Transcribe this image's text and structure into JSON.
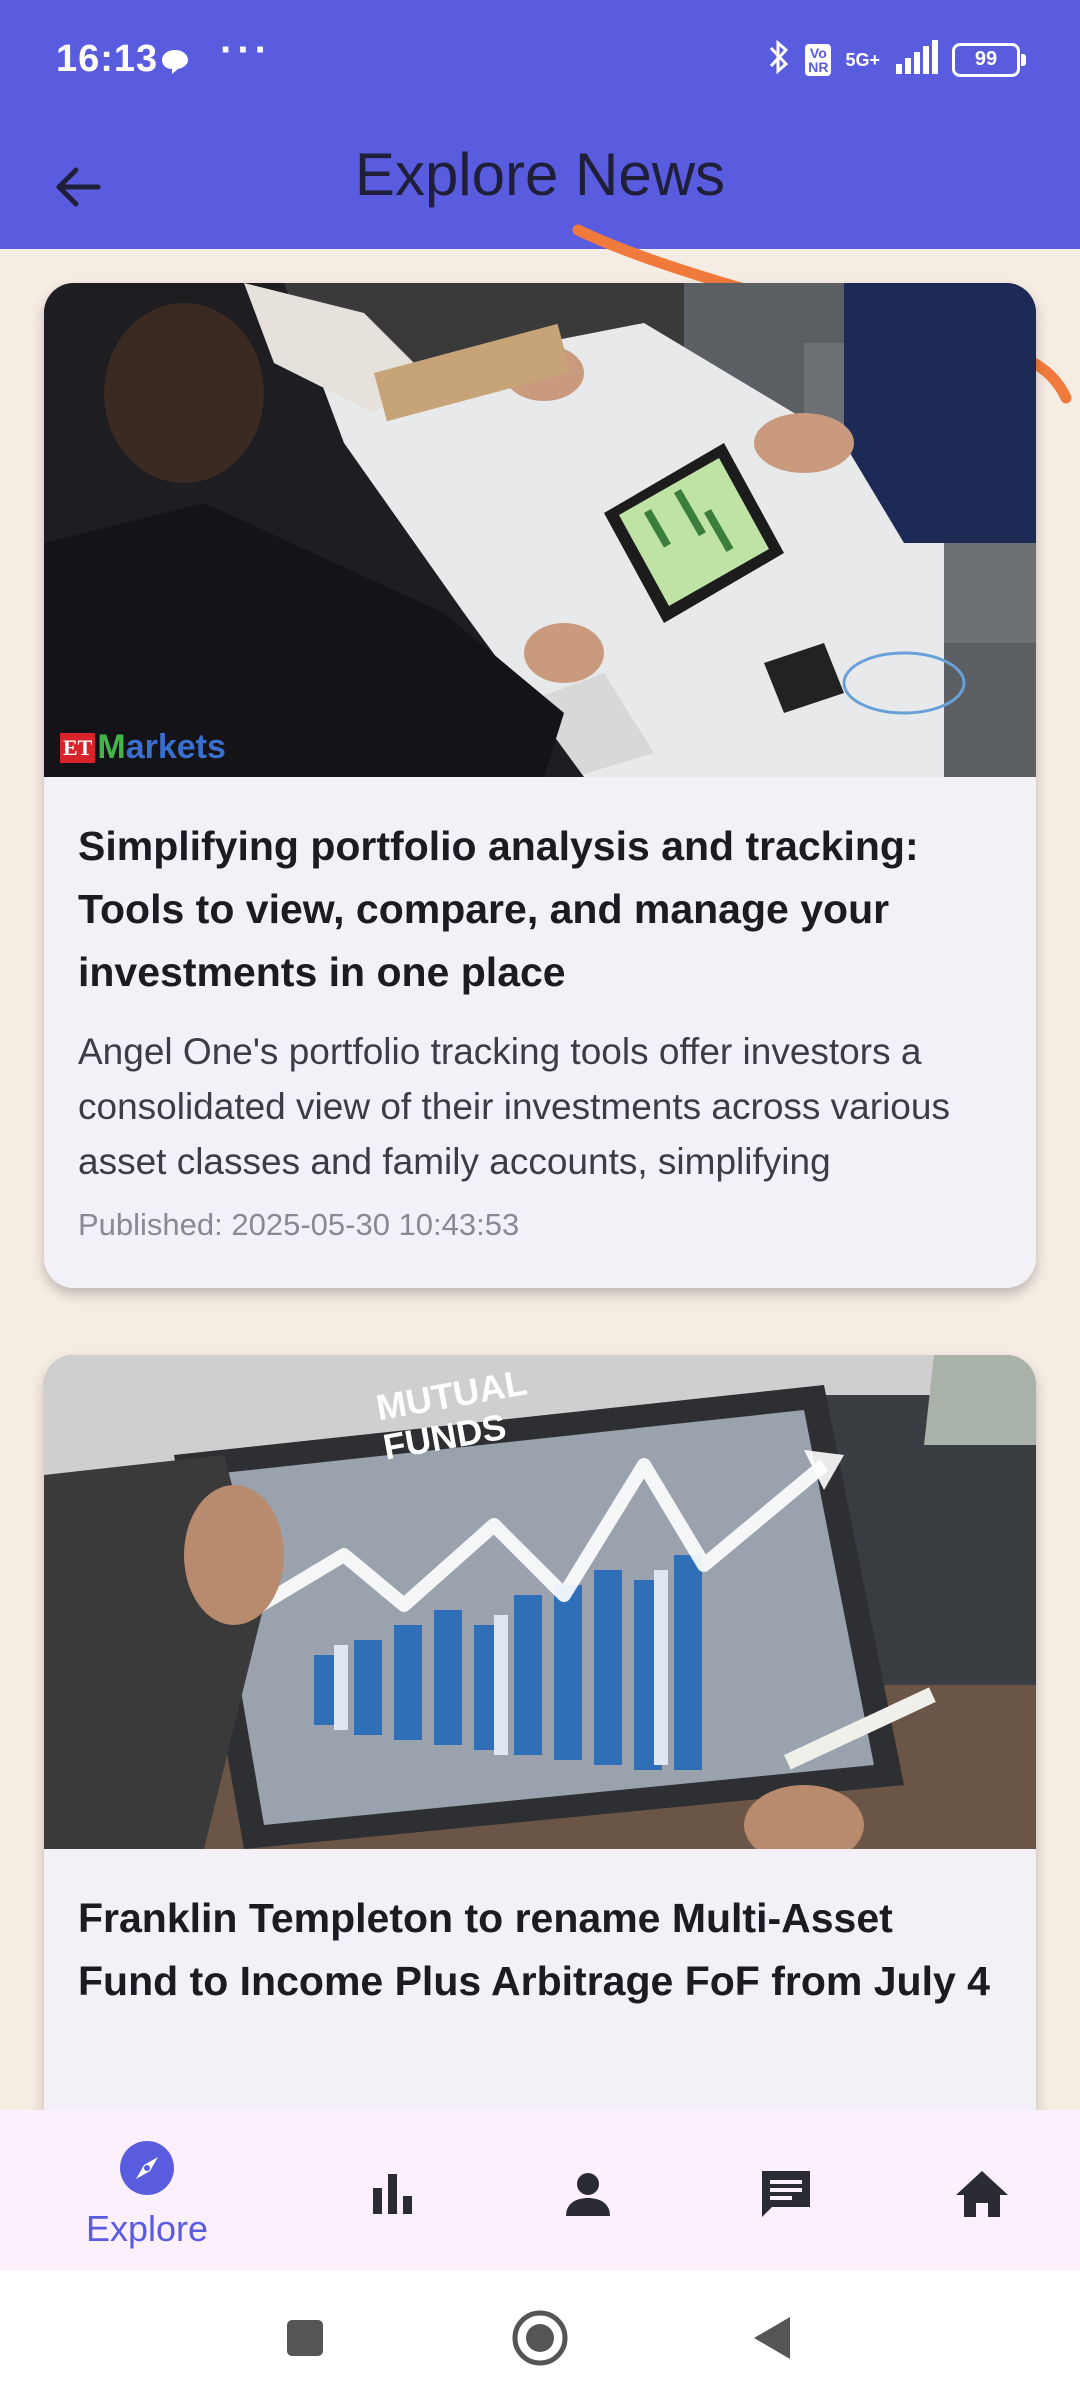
{
  "status_bar": {
    "time": "16:13",
    "dots": "···",
    "network_volte_top": "Vo",
    "network_volte_bottom": "NR",
    "network_label": "5G+",
    "battery_level": "99"
  },
  "app_bar": {
    "title": "Explore News",
    "back_icon": "arrow-left-icon"
  },
  "articles": [
    {
      "title": "Simplifying portfolio analysis and tracking: Tools to view, compare, and manage your investments in one place",
      "summary": "Angel One's portfolio tracking tools offer investors a consolidated view of their investments across various asset classes and family accounts, simplifying",
      "published": "Published: 2025-05-30 10:43:53",
      "image_logo": {
        "et": "ET",
        "brand_m": "M",
        "brand_rest": "arkets"
      }
    },
    {
      "title": "Franklin Templeton to rename Multi-Asset Fund to Income Plus Arbitrage FoF from July 4",
      "image_caption_line1": "MUTUAL",
      "image_caption_line2": "FUNDS"
    }
  ],
  "bottom_nav": {
    "items": [
      {
        "label": "Explore",
        "icon": "compass-icon",
        "active": true
      },
      {
        "label": "",
        "icon": "bar-chart-icon",
        "active": false
      },
      {
        "label": "",
        "icon": "person-icon",
        "active": false
      },
      {
        "label": "",
        "icon": "chat-icon",
        "active": false
      },
      {
        "label": "",
        "icon": "home-icon",
        "active": false
      }
    ]
  },
  "colors": {
    "primary": "#5a5ce0",
    "background": "#f5ece3",
    "card": "#f4f0f7",
    "annotation_stroke": "#f07a3c"
  }
}
